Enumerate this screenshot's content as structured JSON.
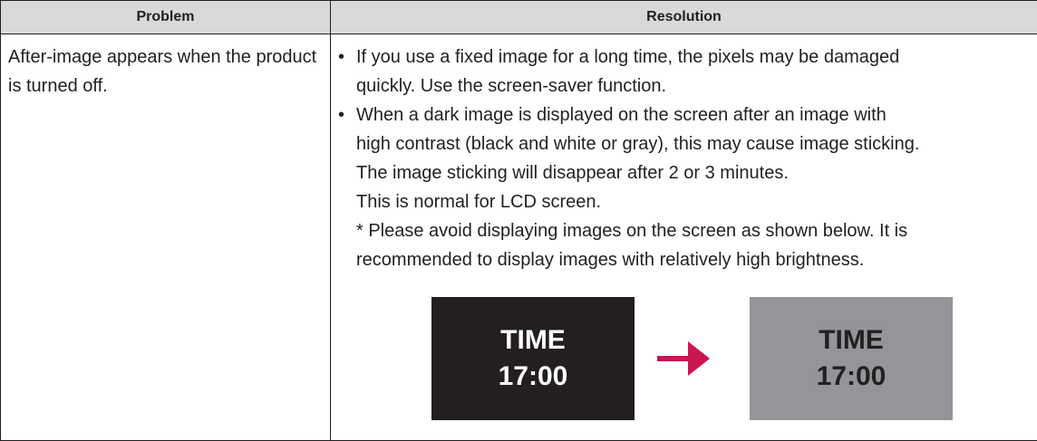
{
  "table": {
    "headers": {
      "problem": "Problem",
      "resolution": "Resolution"
    },
    "rows": [
      {
        "problem": "After-image appears when the product is turned off.",
        "resolution": {
          "bullet_symbol": "•",
          "items": [
            {
              "lines": [
                "If you use a fixed image for a long time, the pixels may be damaged",
                "quickly. Use the screen-saver function."
              ]
            },
            {
              "lines": [
                "When a dark image is displayed on the screen after an image with",
                "high contrast (black and white or gray), this may cause image sticking.",
                "The image sticking will disappear after 2 or 3 minutes.",
                "This is normal for LCD screen.",
                "* Please avoid displaying images on the screen as shown below. It is",
                "recommended to display images with relatively high brightness."
              ]
            }
          ],
          "illustration": {
            "dark_screen": {
              "line1": "TIME",
              "line2": "17:00",
              "background": "#231f20",
              "text_color": "#ffffff"
            },
            "arrow_icon": {
              "name": "arrow-right-icon",
              "color": "#c8174f"
            },
            "gray_screen": {
              "line1": "TIME",
              "line2": "17:00",
              "background": "#939598",
              "text_color": "#231f20"
            }
          }
        }
      }
    ]
  }
}
